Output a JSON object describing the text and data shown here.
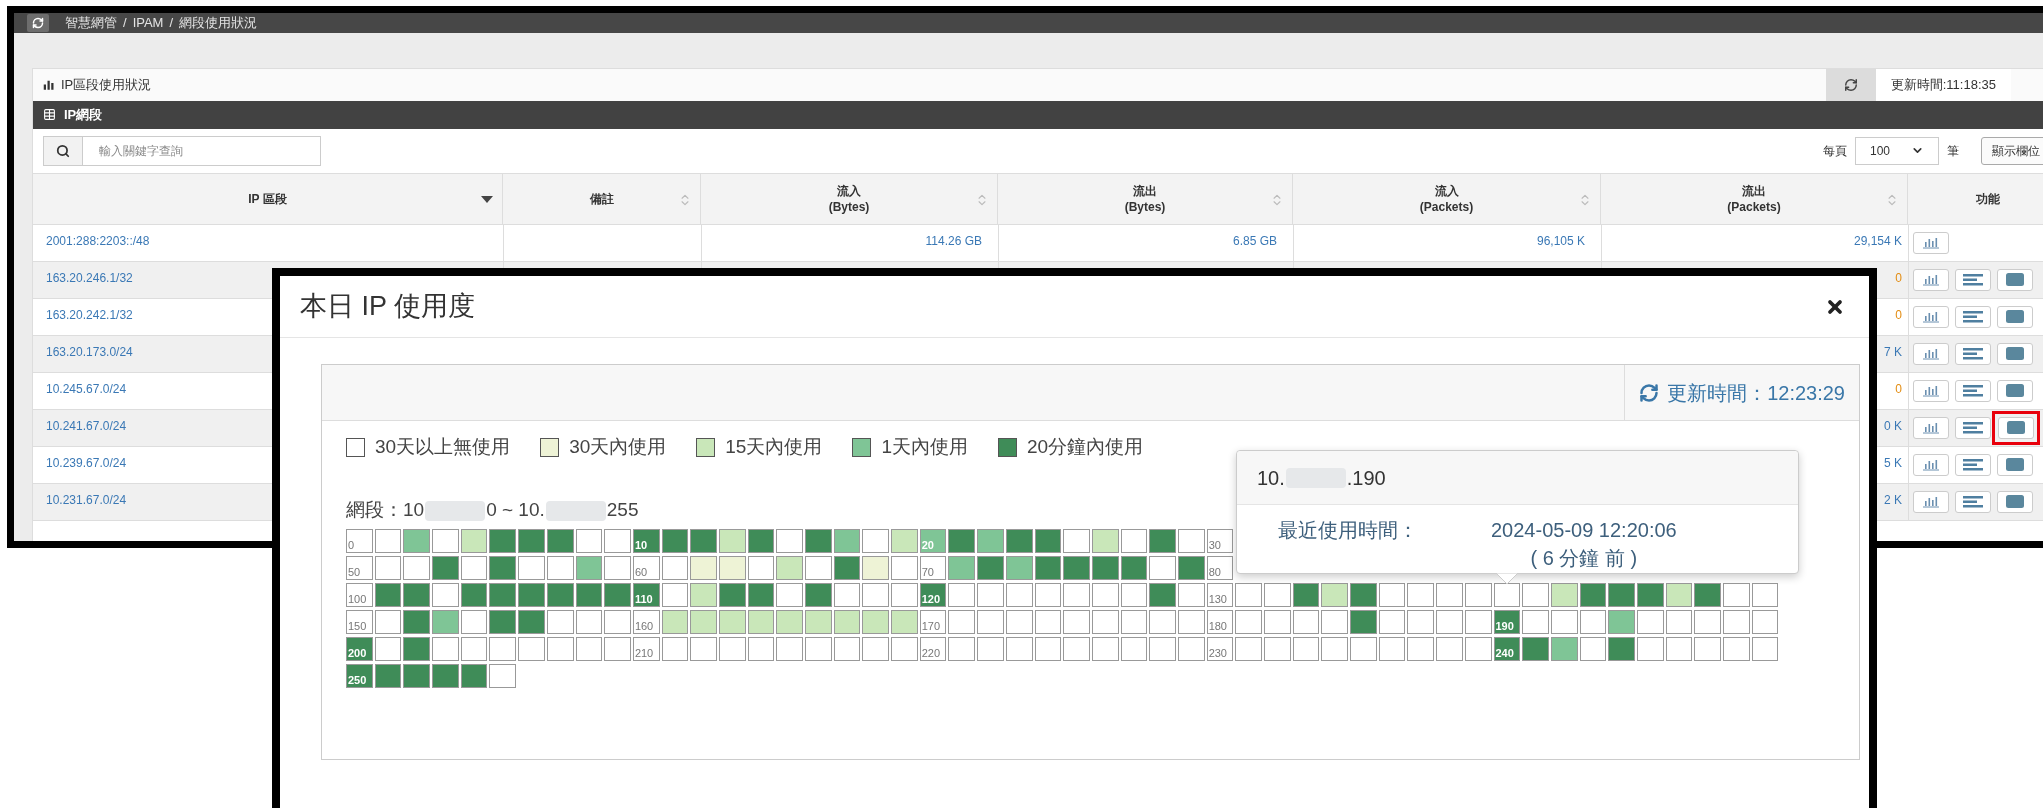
{
  "breadcrumb": [
    {
      "text": "智慧網管",
      "sep": "/"
    },
    {
      "text": "IPAM",
      "sep": "/"
    },
    {
      "text": "網段使用狀況"
    }
  ],
  "panel": {
    "title": "IP區段使用狀況",
    "update_time": "更新時間:11:18:35"
  },
  "section": {
    "title": "IP網段"
  },
  "search": {
    "placeholder": "輸入關鍵字查詢"
  },
  "page_size": {
    "label": "每頁",
    "value": "100",
    "unit": "筆"
  },
  "columns_button": "顯示欄位",
  "table": {
    "columns": [
      {
        "title": "IP 區段",
        "sorted": true
      },
      {
        "title": "備註",
        "sorted": false,
        "sortable": true
      },
      {
        "title": "流入",
        "subtitle": "(Bytes)",
        "sorted": false,
        "sortable": true
      },
      {
        "title": "流出",
        "subtitle": "(Bytes)",
        "sorted": false,
        "sortable": true
      },
      {
        "title": "流入",
        "subtitle": "(Packets)",
        "sorted": false,
        "sortable": true
      },
      {
        "title": "流出",
        "subtitle": "(Packets)",
        "sorted": false,
        "sortable": true
      },
      {
        "title": "功能"
      }
    ],
    "rows": [
      {
        "ip": "2001:288:2203::/48",
        "in_bytes": "114.26 GB",
        "out_bytes": "6.85 GB",
        "in_packets": "96,105 K",
        "out_packets": "29,154 K",
        "actions": [
          {
            "kind": "chart",
            "highlighted": false
          }
        ]
      },
      {
        "ip": "163.20.246.1/32",
        "out_packets": "0",
        "actions": [
          {
            "kind": "chart",
            "highlighted": false
          },
          {
            "kind": "list",
            "highlighted": false
          },
          {
            "kind": "block",
            "highlighted": false
          }
        ]
      },
      {
        "ip": "163.20.242.1/32",
        "out_packets": "0",
        "actions": [
          {
            "kind": "chart",
            "highlighted": false
          },
          {
            "kind": "list",
            "highlighted": false
          },
          {
            "kind": "block",
            "highlighted": false
          }
        ]
      },
      {
        "ip": "163.20.173.0/24",
        "out_packets": "7 K",
        "actions": [
          {
            "kind": "chart",
            "highlighted": false
          },
          {
            "kind": "list",
            "highlighted": false
          },
          {
            "kind": "block",
            "highlighted": false
          }
        ]
      },
      {
        "ip": "10.245.67.0/24",
        "out_packets": "0",
        "actions": [
          {
            "kind": "chart",
            "highlighted": false
          },
          {
            "kind": "list",
            "highlighted": false
          },
          {
            "kind": "block",
            "highlighted": false
          }
        ]
      },
      {
        "ip": "10.241.67.0/24",
        "out_packets": "0 K",
        "actions": [
          {
            "kind": "chart",
            "highlighted": false
          },
          {
            "kind": "list",
            "highlighted": false
          },
          {
            "kind": "block",
            "highlighted": true
          }
        ]
      },
      {
        "ip": "10.239.67.0/24",
        "out_packets": "5 K",
        "actions": [
          {
            "kind": "chart",
            "highlighted": false
          },
          {
            "kind": "list",
            "highlighted": false
          },
          {
            "kind": "block",
            "highlighted": false
          }
        ]
      },
      {
        "ip": "10.231.67.0/24",
        "out_packets": "2 K",
        "actions": [
          {
            "kind": "chart",
            "highlighted": false
          },
          {
            "kind": "list",
            "highlighted": false
          },
          {
            "kind": "block",
            "highlighted": false
          }
        ]
      }
    ]
  },
  "modal": {
    "title": "本日 IP 使用度",
    "update_time": "更新時間：12:23:29",
    "legend": [
      {
        "color": "#ffffff",
        "label": "30天以上無使用"
      },
      {
        "color": "#eef3d6",
        "label": "30天內使用"
      },
      {
        "color": "#c9e7b9",
        "label": "15天內使用"
      },
      {
        "color": "#7fc596",
        "label": "1天內使用"
      },
      {
        "color": "#3f8c58",
        "label": "20分鐘內使用"
      }
    ],
    "range_parts": [
      "網段：10",
      "0 ~ 10.",
      "255"
    ],
    "grid": {
      "rows": [
        {
          "groups": [
            {
              "label": "0",
              "cells": [
                {
                  "color": "#ffffff"
                },
                {
                  "color": "#ffffff"
                },
                {
                  "color": "#7fc596"
                },
                {
                  "color": "#ffffff"
                },
                {
                  "color": "#c9e7b9"
                },
                {
                  "color": "#3f8c58"
                },
                {
                  "color": "#3f8c58"
                },
                {
                  "color": "#3f8c58"
                },
                {
                  "color": "#ffffff"
                },
                {
                  "color": "#ffffff"
                }
              ]
            },
            {
              "label": "10",
              "cells": [
                {
                  "color": "#3f8c58"
                },
                {
                  "color": "#3f8c58"
                },
                {
                  "color": "#3f8c58"
                },
                {
                  "color": "#c9e7b9"
                },
                {
                  "color": "#3f8c58"
                },
                {
                  "color": "#ffffff"
                },
                {
                  "color": "#3f8c58"
                },
                {
                  "color": "#7fc596"
                },
                {
                  "color": "#ffffff"
                },
                {
                  "color": "#c9e7b9"
                }
              ]
            },
            {
              "label": "20",
              "cells": [
                {
                  "color": "#7fc596"
                },
                {
                  "color": "#3f8c58"
                },
                {
                  "color": "#7fc596"
                },
                {
                  "color": "#3f8c58"
                },
                {
                  "color": "#3f8c58"
                },
                {
                  "color": "#ffffff"
                },
                {
                  "color": "#c9e7b9"
                },
                {
                  "color": "#ffffff"
                },
                {
                  "color": "#3f8c58"
                },
                {
                  "color": "#ffffff"
                }
              ]
            },
            {
              "label": "30",
              "cells": [
                {
                  "color": "#ffffff"
                }
              ]
            }
          ]
        },
        {
          "groups": [
            {
              "label": "50",
              "cells": [
                {
                  "color": "#ffffff"
                },
                {
                  "color": "#ffffff"
                },
                {
                  "color": "#ffffff"
                },
                {
                  "color": "#3f8c58"
                },
                {
                  "color": "#ffffff"
                },
                {
                  "color": "#3f8c58"
                },
                {
                  "color": "#ffffff"
                },
                {
                  "color": "#ffffff"
                },
                {
                  "color": "#7fc596"
                },
                {
                  "color": "#ffffff"
                }
              ]
            },
            {
              "label": "60",
              "cells": [
                {
                  "color": "#ffffff"
                },
                {
                  "color": "#ffffff"
                },
                {
                  "color": "#eef3d6"
                },
                {
                  "color": "#eef3d6"
                },
                {
                  "color": "#ffffff"
                },
                {
                  "color": "#c9e7b9"
                },
                {
                  "color": "#ffffff"
                },
                {
                  "color": "#3f8c58"
                },
                {
                  "color": "#eef3d6"
                },
                {
                  "color": "#ffffff"
                }
              ]
            },
            {
              "label": "70",
              "cells": [
                {
                  "color": "#ffffff"
                },
                {
                  "color": "#7fc596"
                },
                {
                  "color": "#3f8c58"
                },
                {
                  "color": "#7fc596"
                },
                {
                  "color": "#3f8c58"
                },
                {
                  "color": "#3f8c58"
                },
                {
                  "color": "#3f8c58"
                },
                {
                  "color": "#3f8c58"
                },
                {
                  "color": "#ffffff"
                },
                {
                  "color": "#3f8c58"
                }
              ]
            },
            {
              "label": "80",
              "cells": [
                {
                  "color": "#ffffff"
                }
              ]
            }
          ]
        },
        {
          "groups": [
            {
              "label": "100",
              "cells": [
                {
                  "color": "#ffffff"
                },
                {
                  "color": "#3f8c58"
                },
                {
                  "color": "#3f8c58"
                },
                {
                  "color": "#ffffff"
                },
                {
                  "color": "#3f8c58"
                },
                {
                  "color": "#3f8c58"
                },
                {
                  "color": "#3f8c58"
                },
                {
                  "color": "#3f8c58"
                },
                {
                  "color": "#3f8c58"
                },
                {
                  "color": "#3f8c58"
                }
              ]
            },
            {
              "label": "110",
              "cells": [
                {
                  "color": "#3f8c58"
                },
                {
                  "color": "#ffffff"
                },
                {
                  "color": "#c9e7b9"
                },
                {
                  "color": "#3f8c58"
                },
                {
                  "color": "#3f8c58"
                },
                {
                  "color": "#ffffff"
                },
                {
                  "color": "#3f8c58"
                },
                {
                  "color": "#ffffff"
                },
                {
                  "color": "#ffffff"
                },
                {
                  "color": "#ffffff"
                }
              ]
            },
            {
              "label": "120",
              "cells": [
                {
                  "color": "#3f8c58"
                },
                {
                  "color": "#ffffff"
                },
                {
                  "color": "#ffffff"
                },
                {
                  "color": "#ffffff"
                },
                {
                  "color": "#ffffff"
                },
                {
                  "color": "#ffffff"
                },
                {
                  "color": "#ffffff"
                },
                {
                  "color": "#ffffff"
                },
                {
                  "color": "#3f8c58"
                },
                {
                  "color": "#ffffff"
                }
              ]
            },
            {
              "label": "130",
              "cells": [
                {
                  "color": "#ffffff"
                },
                {
                  "color": "#ffffff"
                },
                {
                  "color": "#ffffff"
                },
                {
                  "color": "#3f8c58"
                },
                {
                  "color": "#c9e7b9"
                },
                {
                  "color": "#3f8c58"
                },
                {
                  "color": "#ffffff"
                },
                {
                  "color": "#ffffff"
                },
                {
                  "color": "#ffffff"
                },
                {
                  "color": "#ffffff"
                }
              ]
            },
            {
              "cells": [
                {
                  "color": "#ffffff"
                },
                {
                  "color": "#ffffff"
                },
                {
                  "color": "#c9e7b9"
                },
                {
                  "color": "#3f8c58"
                },
                {
                  "color": "#3f8c58"
                },
                {
                  "color": "#3f8c58"
                },
                {
                  "color": "#c9e7b9"
                },
                {
                  "color": "#3f8c58"
                },
                {
                  "color": "#ffffff"
                },
                {
                  "color": "#ffffff"
                }
              ]
            }
          ]
        },
        {
          "groups": [
            {
              "label": "150",
              "cells": [
                {
                  "color": "#ffffff"
                },
                {
                  "color": "#ffffff"
                },
                {
                  "color": "#3f8c58"
                },
                {
                  "color": "#7fc596"
                },
                {
                  "color": "#ffffff"
                },
                {
                  "color": "#3f8c58"
                },
                {
                  "color": "#3f8c58"
                },
                {
                  "color": "#ffffff"
                },
                {
                  "color": "#ffffff"
                },
                {
                  "color": "#ffffff"
                }
              ]
            },
            {
              "label": "160",
              "cells": [
                {
                  "color": "#ffffff"
                },
                {
                  "color": "#c9e7b9"
                },
                {
                  "color": "#c9e7b9"
                },
                {
                  "color": "#c9e7b9"
                },
                {
                  "color": "#c9e7b9"
                },
                {
                  "color": "#c9e7b9"
                },
                {
                  "color": "#c9e7b9"
                },
                {
                  "color": "#c9e7b9"
                },
                {
                  "color": "#c9e7b9"
                },
                {
                  "color": "#c9e7b9"
                }
              ]
            },
            {
              "label": "170",
              "cells": [
                {
                  "color": "#ffffff"
                },
                {
                  "color": "#ffffff"
                },
                {
                  "color": "#ffffff"
                },
                {
                  "color": "#ffffff"
                },
                {
                  "color": "#ffffff"
                },
                {
                  "color": "#ffffff"
                },
                {
                  "color": "#ffffff"
                },
                {
                  "color": "#ffffff"
                },
                {
                  "color": "#ffffff"
                },
                {
                  "color": "#ffffff"
                }
              ]
            },
            {
              "label": "180",
              "cells": [
                {
                  "color": "#ffffff"
                },
                {
                  "color": "#ffffff"
                },
                {
                  "color": "#ffffff"
                },
                {
                  "color": "#ffffff"
                },
                {
                  "color": "#ffffff"
                },
                {
                  "color": "#3f8c58"
                },
                {
                  "color": "#ffffff"
                },
                {
                  "color": "#ffffff"
                },
                {
                  "color": "#ffffff"
                },
                {
                  "color": "#ffffff"
                }
              ]
            },
            {
              "label": "190",
              "cells": [
                {
                  "color": "#3f8c58"
                },
                {
                  "color": "#ffffff"
                },
                {
                  "color": "#ffffff"
                },
                {
                  "color": "#ffffff"
                },
                {
                  "color": "#7fc596"
                },
                {
                  "color": "#ffffff"
                },
                {
                  "color": "#ffffff"
                },
                {
                  "color": "#ffffff"
                },
                {
                  "color": "#ffffff"
                },
                {
                  "color": "#ffffff"
                }
              ]
            }
          ]
        },
        {
          "groups": [
            {
              "label": "200",
              "cells": [
                {
                  "color": "#3f8c58"
                },
                {
                  "color": "#ffffff"
                },
                {
                  "color": "#3f8c58"
                },
                {
                  "color": "#ffffff"
                },
                {
                  "color": "#ffffff"
                },
                {
                  "color": "#ffffff"
                },
                {
                  "color": "#ffffff"
                },
                {
                  "color": "#ffffff"
                },
                {
                  "color": "#ffffff"
                },
                {
                  "color": "#ffffff"
                }
              ]
            },
            {
              "label": "210",
              "cells": [
                {
                  "color": "#ffffff"
                },
                {
                  "color": "#ffffff"
                },
                {
                  "color": "#ffffff"
                },
                {
                  "color": "#ffffff"
                },
                {
                  "color": "#ffffff"
                },
                {
                  "color": "#ffffff"
                },
                {
                  "color": "#ffffff"
                },
                {
                  "color": "#ffffff"
                },
                {
                  "color": "#ffffff"
                },
                {
                  "color": "#ffffff"
                }
              ]
            },
            {
              "label": "220",
              "cells": [
                {
                  "color": "#ffffff"
                },
                {
                  "color": "#ffffff"
                },
                {
                  "color": "#ffffff"
                },
                {
                  "color": "#ffffff"
                },
                {
                  "color": "#ffffff"
                },
                {
                  "color": "#ffffff"
                },
                {
                  "color": "#ffffff"
                },
                {
                  "color": "#ffffff"
                },
                {
                  "color": "#ffffff"
                },
                {
                  "color": "#ffffff"
                }
              ]
            },
            {
              "label": "230",
              "cells": [
                {
                  "color": "#ffffff"
                },
                {
                  "color": "#ffffff"
                },
                {
                  "color": "#ffffff"
                },
                {
                  "color": "#ffffff"
                },
                {
                  "color": "#ffffff"
                },
                {
                  "color": "#ffffff"
                },
                {
                  "color": "#ffffff"
                },
                {
                  "color": "#ffffff"
                },
                {
                  "color": "#ffffff"
                },
                {
                  "color": "#ffffff"
                }
              ]
            },
            {
              "label": "240",
              "cells": [
                {
                  "color": "#3f8c58"
                },
                {
                  "color": "#3f8c58"
                },
                {
                  "color": "#7fc596"
                },
                {
                  "color": "#ffffff"
                },
                {
                  "color": "#3f8c58"
                },
                {
                  "color": "#ffffff"
                },
                {
                  "color": "#ffffff"
                },
                {
                  "color": "#ffffff"
                },
                {
                  "color": "#ffffff"
                },
                {
                  "color": "#ffffff"
                }
              ]
            }
          ]
        },
        {
          "groups": [
            {
              "label": "250",
              "cells": [
                {
                  "color": "#3f8c58"
                },
                {
                  "color": "#3f8c58"
                },
                {
                  "color": "#3f8c58"
                },
                {
                  "color": "#3f8c58"
                },
                {
                  "color": "#3f8c58"
                },
                {
                  "color": "#ffffff"
                }
              ]
            }
          ]
        }
      ]
    },
    "tooltip": {
      "ip_parts": [
        "10.",
        ".190"
      ],
      "label": "最近使用時間：",
      "value": "2024-05-09 12:20:06",
      "ago": "( 6 分鐘 前 )"
    }
  }
}
